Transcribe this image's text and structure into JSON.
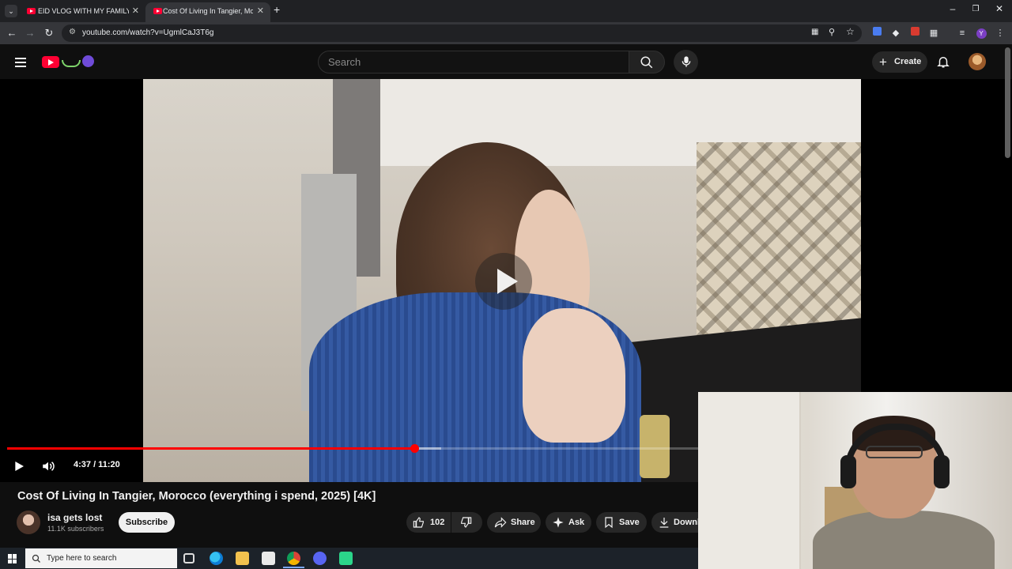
{
  "browser": {
    "tabs": [
      {
        "title": "EID VLOG WITH MY FAMILY I 🥰",
        "active": false
      },
      {
        "title": "Cost Of Living In Tangier, Moroc",
        "active": true
      }
    ],
    "url": "youtube.com/watch?v=UgmlCaJ3T6g"
  },
  "masthead": {
    "search_placeholder": "Search",
    "create_label": "Create"
  },
  "player": {
    "current_time": "4:37",
    "duration": "11:20",
    "time_display": "4:37 / 11:20",
    "progress_fraction": 0.408,
    "buffered_fraction": 0.435
  },
  "video": {
    "title": "Cost Of Living In Tangier, Morocco (everything i spend, 2025) [4K]",
    "channel_name": "isa gets lost",
    "subscribers": "11.1K subscribers",
    "subscribe_label": "Subscribe",
    "likes": "102",
    "share_label": "Share",
    "ask_label": "Ask",
    "save_label": "Save",
    "download_label": "Downl"
  },
  "taskbar": {
    "search_placeholder": "Type here to search"
  },
  "colors": {
    "accent_red": "#ff0000",
    "background": "#0f0f0f"
  }
}
